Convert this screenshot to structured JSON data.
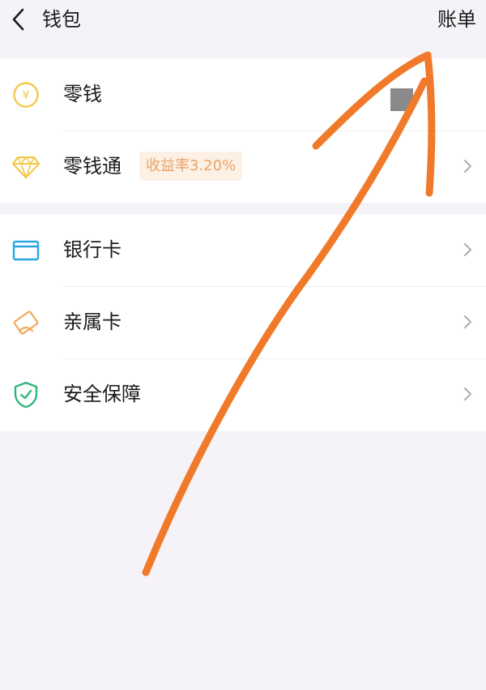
{
  "header": {
    "title": "钱包",
    "bill_label": "账单"
  },
  "wallet": {
    "items": [
      {
        "label": "零钱",
        "icon": "yuan-coin-icon",
        "icon_color": "#f2c94c"
      },
      {
        "label": "零钱通",
        "icon": "diamond-icon",
        "icon_color": "#f2c94c",
        "badge": "收益率3.20%"
      }
    ]
  },
  "cards": {
    "items": [
      {
        "label": "银行卡",
        "icon": "bank-card-icon",
        "icon_color": "#29a8e0"
      },
      {
        "label": "亲属卡",
        "icon": "family-card-icon",
        "icon_color": "#f0a85b"
      },
      {
        "label": "安全保障",
        "icon": "shield-icon",
        "icon_color": "#2fb67a"
      }
    ]
  },
  "colors": {
    "annotation_arrow": "#f07a2a",
    "badge_text": "#e8a36a",
    "badge_bg": "#fdf0e4"
  }
}
